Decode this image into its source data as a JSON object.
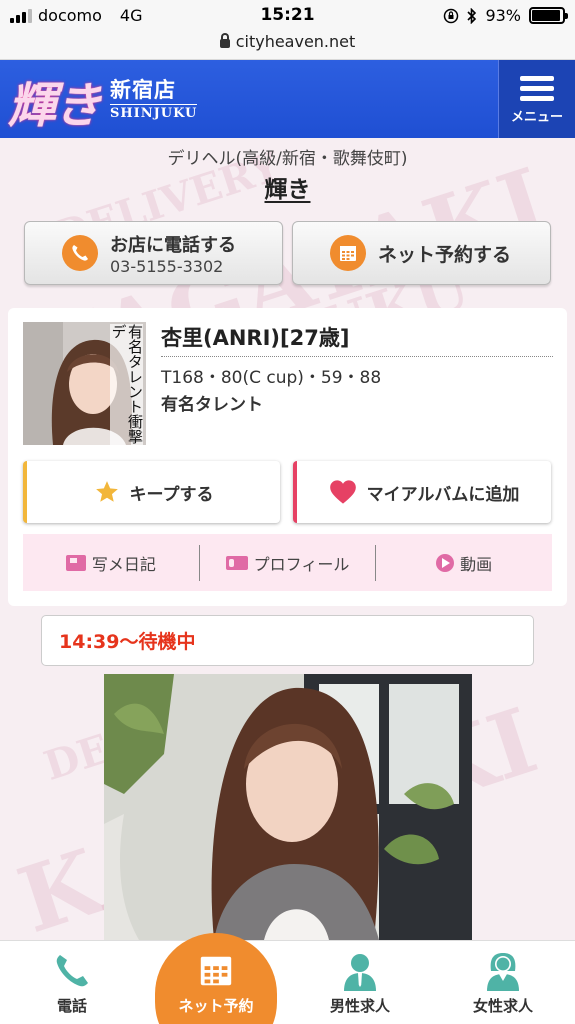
{
  "status_bar": {
    "carrier": "docomo",
    "network": "4G",
    "time": "15:21",
    "battery": "93%",
    "battery_level": 0.93,
    "url": "cityheaven.net"
  },
  "header": {
    "logo_main": "輝き",
    "logo_branch": "新宿店",
    "logo_roman": "SHINJUKU",
    "menu_label": "メニュー"
  },
  "watermark": {
    "words": [
      "DELIVERY",
      "KAGAYAKI",
      "SHINJUKU"
    ]
  },
  "shop": {
    "category": "デリヘル(高級/新宿・歌舞伎町)",
    "name": "輝き",
    "call_label": "お店に電話する",
    "phone": "03-5155-3302",
    "reserve_label": "ネット予約する"
  },
  "profile": {
    "thumb_tag": "有名タレント衝撃デ",
    "name": "杏里(ANRI)[27歳]",
    "size": "T168・80(C cup)・59・88",
    "comment": "有名タレント",
    "keep_label": "キープする",
    "album_label": "マイアルバムに追加",
    "tabs": [
      {
        "label": "写メ日記",
        "icon": "diary-icon"
      },
      {
        "label": "プロフィール",
        "icon": "profile-card-icon"
      },
      {
        "label": "動画",
        "icon": "play-icon"
      }
    ]
  },
  "status": {
    "text": "14:39〜待機中"
  },
  "bottom_nav": {
    "items": [
      {
        "label": "電話",
        "icon": "phone-icon"
      },
      {
        "label": "ネット予約",
        "icon": "calendar-icon"
      },
      {
        "label": "男性求人",
        "icon": "man-icon"
      },
      {
        "label": "女性求人",
        "icon": "woman-icon"
      }
    ]
  },
  "colors": {
    "header_blue": "#2552d9",
    "orange": "#f08c2e",
    "status_red": "#e6341c",
    "keep_yellow": "#f2b63a",
    "album_red": "#e64164",
    "tab_pink": "#fde8f1",
    "nav_teal": "#4fb3a6"
  }
}
